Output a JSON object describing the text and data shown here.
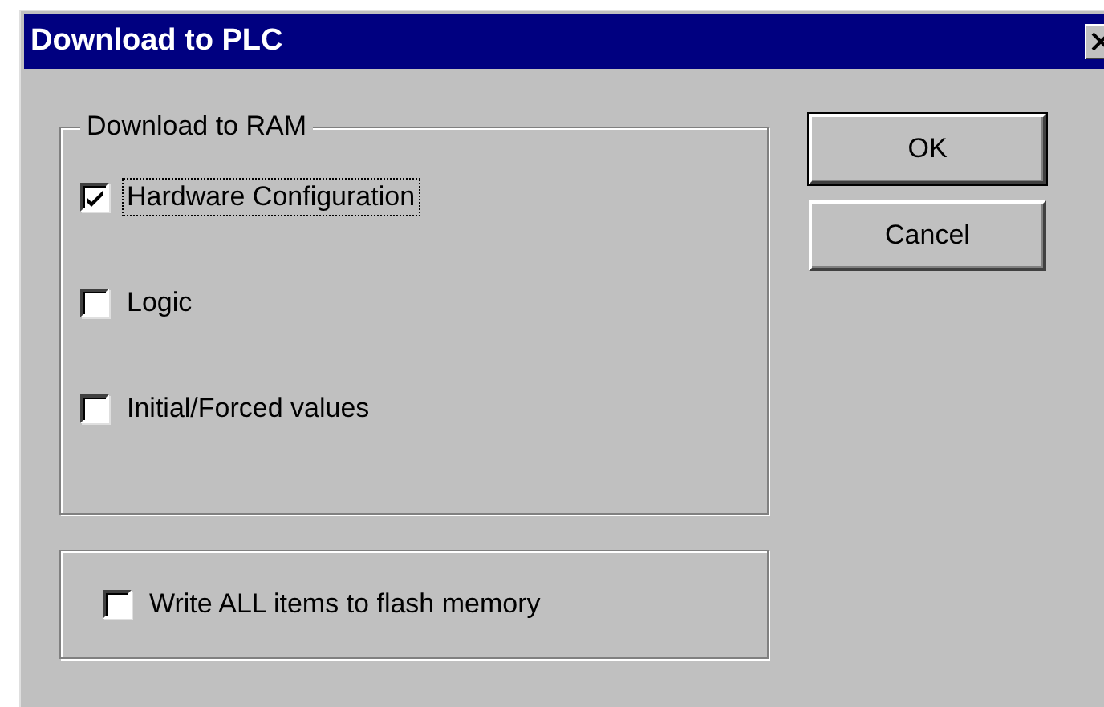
{
  "window": {
    "title": "Download to PLC"
  },
  "ram_group": {
    "title": "Download to RAM",
    "items": [
      {
        "label": "Hardware Configuration",
        "checked": true,
        "focused": true
      },
      {
        "label": "Logic",
        "checked": false,
        "focused": false
      },
      {
        "label": "Initial/Forced values",
        "checked": false,
        "focused": false
      }
    ]
  },
  "flash_option": {
    "label": "Write ALL items to flash memory",
    "checked": false,
    "focused": false
  },
  "buttons": [
    {
      "label": "OK",
      "default": true
    },
    {
      "label": "Cancel",
      "default": false
    }
  ]
}
